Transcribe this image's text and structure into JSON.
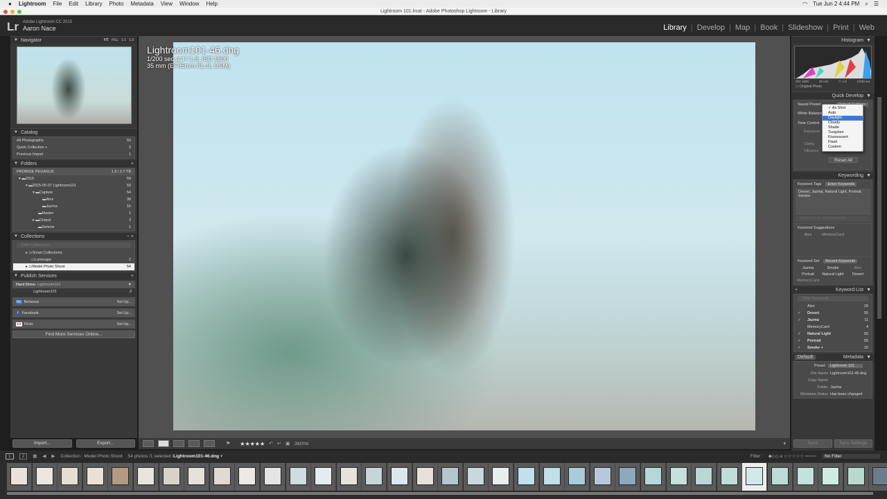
{
  "menubar": {
    "app": "Lightroom",
    "items": [
      "File",
      "Edit",
      "Library",
      "Photo",
      "Metadata",
      "View",
      "Window",
      "Help"
    ],
    "clock": "Tue Jun 2  4:44 PM"
  },
  "window_title": "Lightroom 101.lrcat - Adobe Photoshop Lightroom - Library",
  "identity": {
    "product": "Adobe Lightroom CC 2015",
    "user": "Aaron Nace",
    "logo": "Lr"
  },
  "modules": [
    {
      "label": "Library",
      "active": true
    },
    {
      "label": "Develop"
    },
    {
      "label": "Map"
    },
    {
      "label": "Book"
    },
    {
      "label": "Slideshow"
    },
    {
      "label": "Print"
    },
    {
      "label": "Web"
    }
  ],
  "navigator": {
    "title": "Navigator",
    "zoom": [
      "FIT",
      "FILL",
      "1:1",
      "1:3"
    ]
  },
  "catalog": {
    "title": "Catalog",
    "items": [
      {
        "label": "All Photographs",
        "count": "59"
      },
      {
        "label": "Quick Collection +",
        "count": "0"
      },
      {
        "label": "Previous Import",
        "count": "1"
      }
    ]
  },
  "folders": {
    "title": "Folders",
    "volume": "PROMISE PEGASUS",
    "volume_size": "1.3 / 2.7 TB",
    "items": [
      {
        "label": "2015",
        "count": "59"
      },
      {
        "label": "2015-05-07 Lightroom101",
        "count": "59"
      },
      {
        "label": "Capture",
        "count": "54"
      },
      {
        "label": "Alex",
        "count": "38"
      },
      {
        "label": "Jazma",
        "count": "16"
      },
      {
        "label": "Master",
        "count": "1"
      },
      {
        "label": "Output",
        "count": "3"
      },
      {
        "label": "Selects",
        "count": "1"
      }
    ]
  },
  "collections": {
    "title": "Collections",
    "filter_placeholder": "Filter Collections",
    "items": [
      {
        "label": "Smart Collections",
        "count": ""
      },
      {
        "label": "Lanscape",
        "count": "2"
      },
      {
        "label": "Model Photo Shoot",
        "count": "54",
        "selected": true
      }
    ]
  },
  "publish": {
    "title": "Publish Services",
    "hard_drive": "Hard Drive",
    "hard_drive_sub": ": Lightroom101",
    "sub_item": "Lightroom101",
    "sub_count": "2",
    "services": [
      {
        "label": "Behance",
        "action": "Set Up..."
      },
      {
        "label": "Facebook",
        "action": "Set Up..."
      },
      {
        "label": "Flickr",
        "action": "Set Up..."
      }
    ],
    "find_more": "Find More Services Online..."
  },
  "left_buttons": {
    "import": "Import...",
    "export": "Export..."
  },
  "photo": {
    "filename": "Lightroom101-46.dng",
    "exposure": "1/200 sec at f / 1.8, ISO 1600",
    "lens": "35 mm (EF35mm f/1.4L USM)"
  },
  "toolbar": {
    "stars": "★★★★★",
    "keyword": "Jazma"
  },
  "histogram": {
    "title": "Histogram",
    "iso": "ISO 1600",
    "focal": "35 mm",
    "aperture": "f / 1.8",
    "shutter": "1/200 sec",
    "original": "Original Photo"
  },
  "quick_develop": {
    "title": "Quick Develop",
    "saved_preset_label": "Saved Preset",
    "saved_preset": "Default Settings",
    "white_balance_label": "White Balance",
    "tone_control_label": "Tone Control",
    "exposure_label": "Exposure",
    "clarity_label": "Clarity",
    "vibrance_label": "Vibrance",
    "reset": "Reset All",
    "wb_options": [
      "As Shot",
      "Auto",
      "Daylight",
      "Cloudy",
      "Shade",
      "Tungsten",
      "Fluorescent",
      "Flash",
      "Custom"
    ],
    "wb_checked": "As Shot",
    "wb_highlighted": "Daylight"
  },
  "keywording": {
    "title": "Keywording",
    "tags_label": "Keyword Tags",
    "tags_mode": "Enter Keywords",
    "tags": "Desert, Jazma, Natural Light, Portrait, Smoke",
    "add_placeholder": "Click here to add keywords",
    "suggestions_label": "Keyword Suggestions",
    "suggestions": [
      "Alex",
      "MemoryCard"
    ],
    "set_label": "Keyword Set",
    "set_mode": "Recent Keywords",
    "set": [
      "Jazma",
      "Smoke",
      "Alex",
      "Portrait",
      "Natural Light",
      "Desert",
      "MemoryCard"
    ]
  },
  "keyword_list": {
    "title": "Keyword List",
    "filter_placeholder": "Filter Keywords",
    "items": [
      {
        "label": "Alex",
        "count": "29",
        "checked": false
      },
      {
        "label": "Desert",
        "count": "55",
        "checked": true
      },
      {
        "label": "Jazma",
        "count": "11",
        "checked": true
      },
      {
        "label": "MemoryCard",
        "count": "4",
        "checked": false
      },
      {
        "label": "Natural Light",
        "count": "55",
        "checked": true
      },
      {
        "label": "Portrait",
        "count": "55",
        "checked": true
      },
      {
        "label": "Smoke +",
        "count": "15",
        "checked": true
      }
    ]
  },
  "metadata": {
    "title": "Metadata",
    "view": "Default",
    "preset_label": "Preset",
    "preset": "Lightroom 101",
    "fields": [
      {
        "label": "File Name",
        "value": "Lightroom101-46.dng"
      },
      {
        "label": "Copy Name",
        "value": ""
      },
      {
        "label": "Folder",
        "value": "Jazma"
      },
      {
        "label": "Metadata Status",
        "value": "Has been changed"
      }
    ]
  },
  "sync": {
    "sync": "Sync",
    "sync_settings": "Sync Settings"
  },
  "filmstrip": {
    "screens": [
      "1",
      "2"
    ],
    "source": "Collection : Model Photo Shoot",
    "count": "54 photos /1 selected /",
    "selected_file": "Lightroom101-46.dng",
    "filter_label": "Filter :",
    "filter_value": "No Filter",
    "thumb_tones": [
      "#e8e2dc",
      "#eae6e2",
      "#e6ddd4",
      "#e9e1d8",
      "#b59a82",
      "#e8e4de",
      "#d8d2cc",
      "#e4e0da",
      "#e0dad4",
      "#ece8e4",
      "#e4e4e4",
      "#d0dce0",
      "#e4ecee",
      "#e6e2dc",
      "#c8d4d8",
      "#dde6ea",
      "#e8e0d8",
      "#b6c6cc",
      "#cad8dc",
      "#e8eef0",
      "#bfe0ec",
      "#c0dfe8",
      "#a8ccd8",
      "#b8c8dc",
      "#8ea8bc",
      "#b4d8d8",
      "#c6e0dc",
      "#b8d8d4",
      "#c2dcd8",
      "#d4e8e8",
      "#bcdcd8",
      "#c2e2dc",
      "#d0ece0",
      "#b8d8cc",
      "#6a7e8e"
    ],
    "selected_index": 29
  }
}
